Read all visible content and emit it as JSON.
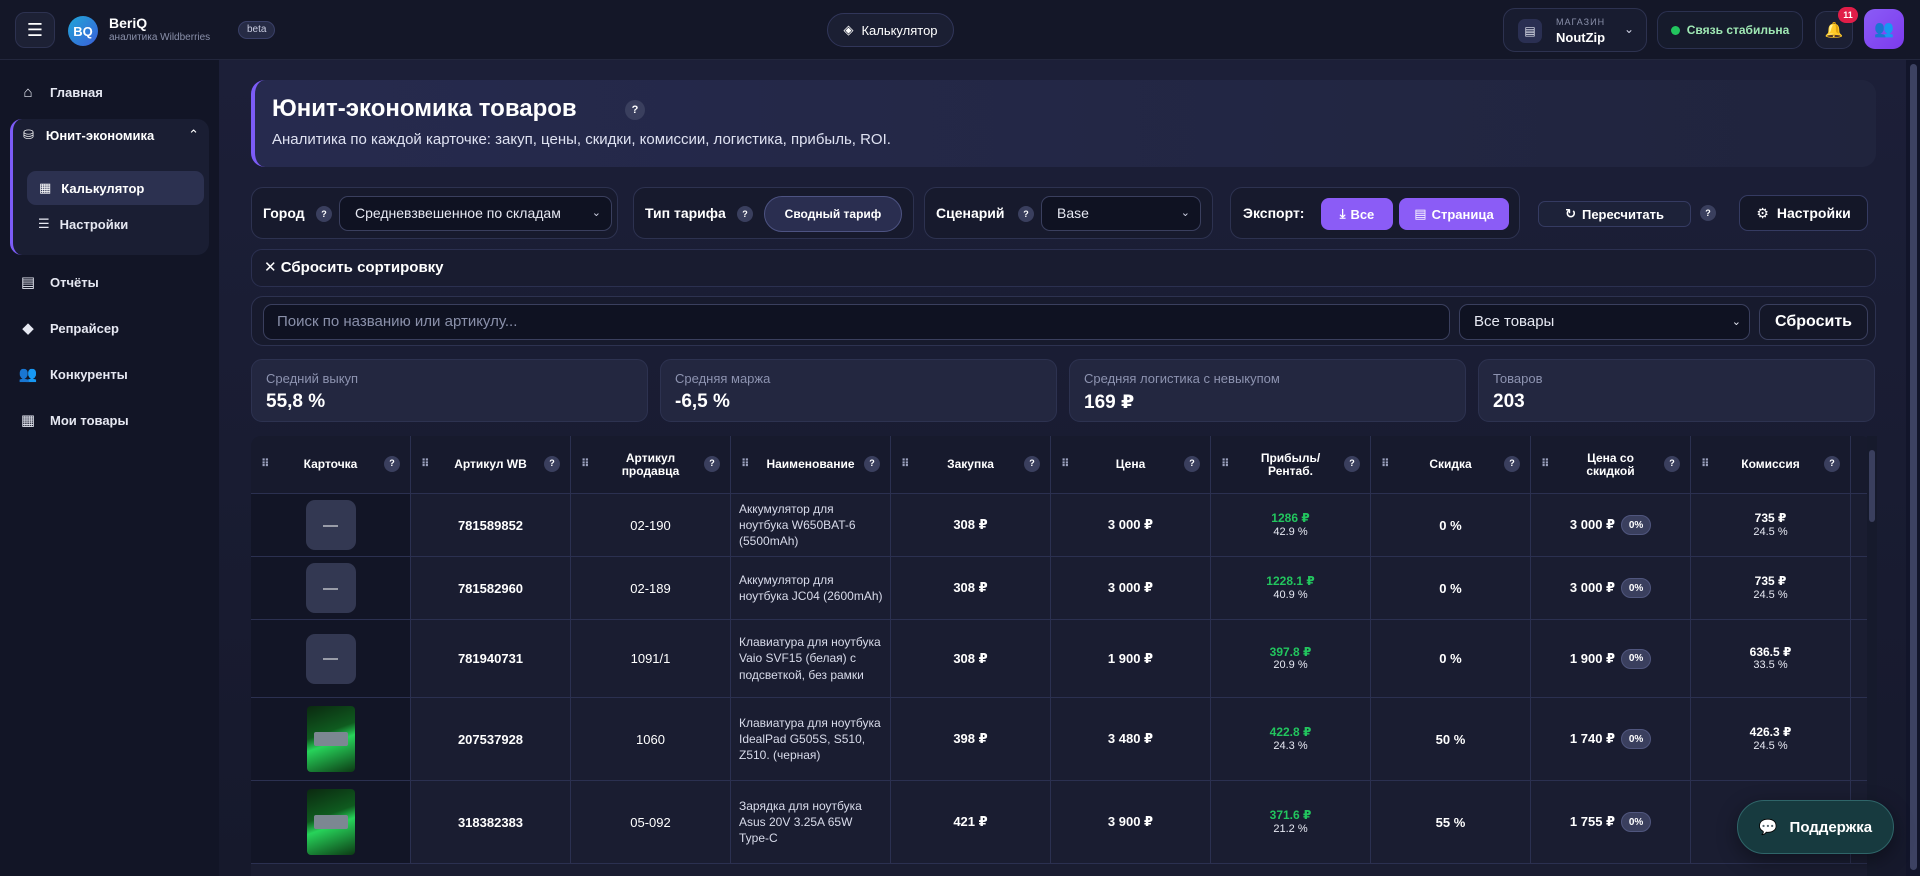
{
  "header": {
    "logo_text": "BQ",
    "app_name": "BeriQ",
    "app_subtitle": "аналитика Wildberries",
    "beta_label": "beta",
    "center_pill": "Калькулятор",
    "shop_label": "МАГАЗИН",
    "shop_name": "NoutZip",
    "connection_status": "Связь стабильна",
    "notifications_count": "11"
  },
  "sidebar": {
    "home": "Главная",
    "unit_econ": "Юнит-экономика",
    "calculator": "Калькулятор",
    "settings": "Настройки",
    "reports": "Отчёты",
    "repricer": "Репрайсер",
    "competitors": "Конкуренты",
    "my_products": "Мои товары"
  },
  "page": {
    "title": "Юнит-экономика товаров",
    "subtitle": "Аналитика по каждой карточке: закуп, цены, скидки, комиссии, логистика, прибыль, ROI."
  },
  "controls": {
    "city_label": "Город",
    "city_value": "Средневзвешенное по складам",
    "tariff_label": "Тип тарифа",
    "tariff_value": "Сводный тариф",
    "scenario_label": "Сценарий",
    "scenario_value": "Base",
    "export_label": "Экспорт:",
    "export_all": "Все",
    "export_page": "Страница",
    "recalc": "Пересчитать",
    "settings": "Настройки",
    "reset_sort": "Сбросить сортировку",
    "search_placeholder": "Поиск по названию или артикулу...",
    "filter_value": "Все товары",
    "reset": "Сбросить"
  },
  "kpis": [
    {
      "label": "Средний выкуп",
      "value": "55,8 %"
    },
    {
      "label": "Средняя маржа",
      "value": "-6,5 %"
    },
    {
      "label": "Средняя логистика с невыкупом",
      "value": "169 ₽"
    },
    {
      "label": "Товаров",
      "value": "203"
    }
  ],
  "table": {
    "columns": [
      "Карточка",
      "Артикул WB",
      "Артикул продавца",
      "Наименование",
      "Закупка",
      "Цена",
      "Прибыль/ Рентаб.",
      "Скидка",
      "Цена со скидкой",
      "Комиссия"
    ],
    "rows": [
      {
        "card": "—",
        "wb": "781589852",
        "seller": "02-190",
        "name": "Аккумулятор для ноутбука W650BAT-6 (5500mAh)",
        "purchase": "308 ₽",
        "price": "3 000 ₽",
        "profit": "1286 ₽",
        "margin": "42.9 %",
        "discount": "0 %",
        "discounted": "3 000 ₽",
        "disc_badge": "0%",
        "commission": "735 ₽",
        "commission_pct": "24.5 %"
      },
      {
        "card": "—",
        "wb": "781582960",
        "seller": "02-189",
        "name": "Аккумулятор для ноутбука JC04 (2600mAh)",
        "purchase": "308 ₽",
        "price": "3 000 ₽",
        "profit": "1228.1 ₽",
        "margin": "40.9 %",
        "discount": "0 %",
        "discounted": "3 000 ₽",
        "disc_badge": "0%",
        "commission": "735 ₽",
        "commission_pct": "24.5 %"
      },
      {
        "card": "—",
        "wb": "781940731",
        "seller": "1091/1",
        "name": "Клавиатура для ноутбука Vaio SVF15 (белая) с подсветкой, без рамки",
        "purchase": "308 ₽",
        "price": "1 900 ₽",
        "profit": "397.8 ₽",
        "margin": "20.9 %",
        "discount": "0 %",
        "discounted": "1 900 ₽",
        "disc_badge": "0%",
        "commission": "636.5 ₽",
        "commission_pct": "33.5 %"
      },
      {
        "card": "",
        "wb": "207537928",
        "seller": "1060",
        "name": "Клавиатура для ноутбука IdealPad G505S, S510, Z510. (черная)",
        "purchase": "398 ₽",
        "price": "3 480 ₽",
        "profit": "422.8 ₽",
        "margin": "24.3 %",
        "discount": "50 %",
        "discounted": "1 740 ₽",
        "disc_badge": "0%",
        "commission": "426.3 ₽",
        "commission_pct": "24.5 %"
      },
      {
        "card": "",
        "wb": "318382383",
        "seller": "05-092",
        "name": "Зарядка для ноутбука Asus 20V 3.25A 65W Type-C",
        "purchase": "421 ₽",
        "price": "3 900 ₽",
        "profit": "371.6 ₽",
        "margin": "21.2 %",
        "discount": "55 %",
        "discounted": "1 755 ₽",
        "disc_badge": "0%",
        "commission": "",
        "commission_pct": ""
      }
    ]
  },
  "support": "Поддержка"
}
